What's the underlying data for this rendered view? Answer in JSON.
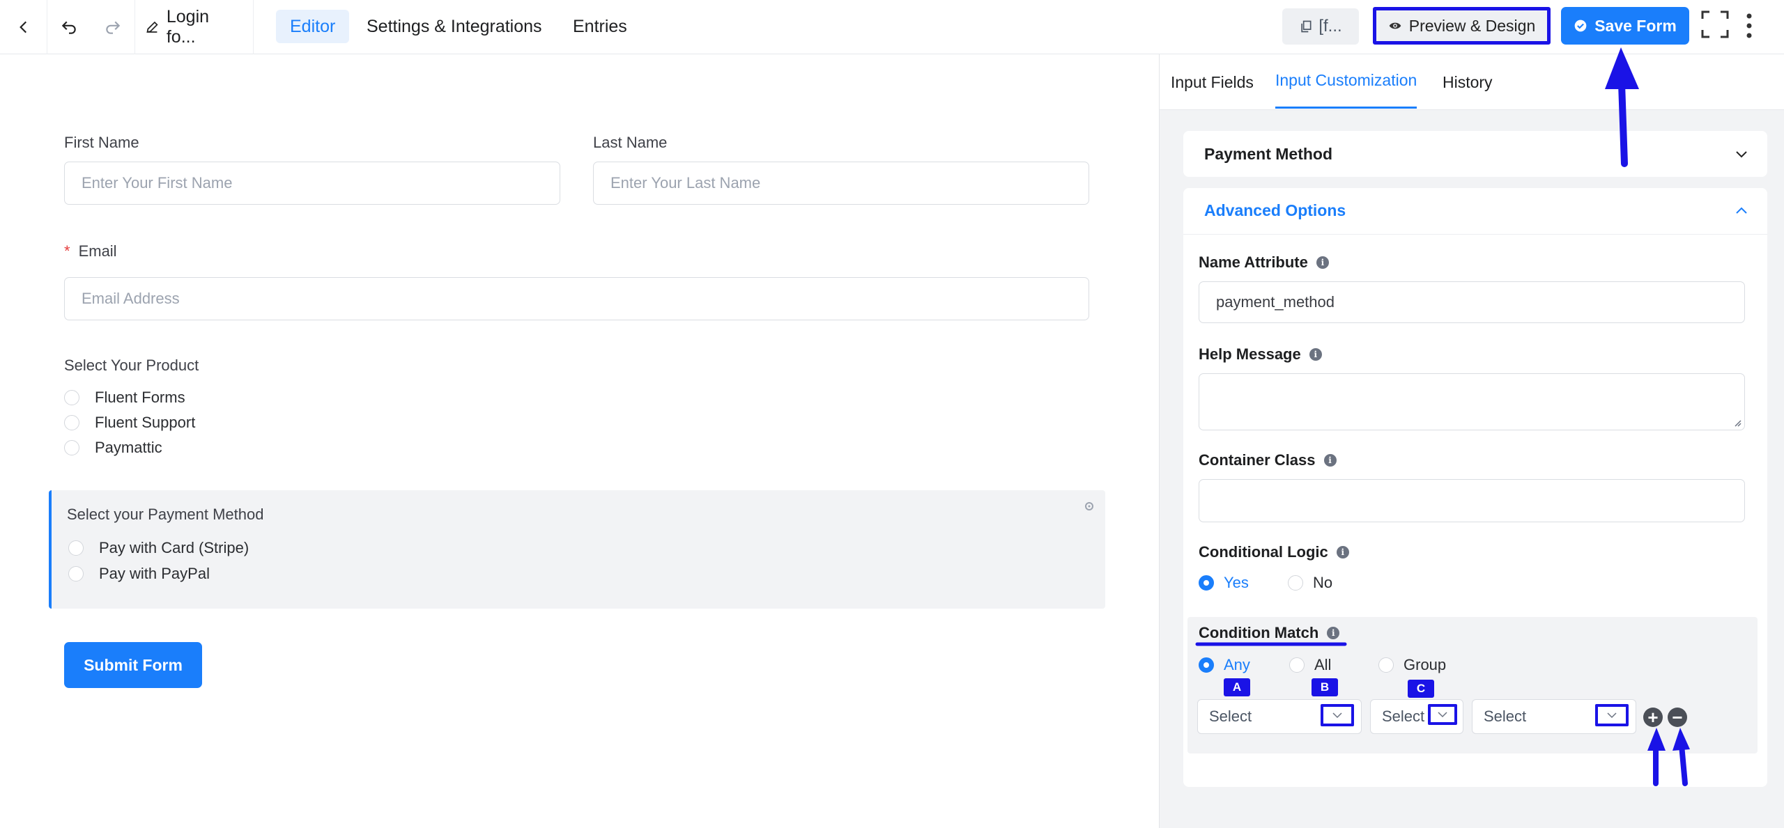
{
  "toolbar": {
    "form_title": "Login fo...",
    "tabs": [
      "Editor",
      "Settings & Integrations",
      "Entries"
    ],
    "shortcode": "[f...",
    "preview_label": "Preview & Design",
    "save_label": "Save Form"
  },
  "form": {
    "first_name_label": "First Name",
    "first_name_placeholder": "Enter Your First Name",
    "last_name_label": "Last Name",
    "last_name_placeholder": "Enter Your Last Name",
    "email_required_mark": "*",
    "email_label": "Email",
    "email_placeholder": "Email Address",
    "product_label": "Select Your Product",
    "products": [
      "Fluent Forms",
      "Fluent Support",
      "Paymattic"
    ],
    "payment_label": "Select your Payment Method",
    "payment_options": [
      "Pay with Card (Stripe)",
      "Pay with PayPal"
    ],
    "submit_label": "Submit Form"
  },
  "panel": {
    "tabs": [
      "Input Fields",
      "Input Customization",
      "History"
    ],
    "payment_method_header": "Payment Method",
    "advanced_header": "Advanced Options",
    "name_attribute_label": "Name Attribute",
    "name_attribute_value": "payment_method",
    "help_message_label": "Help Message",
    "help_message_value": "",
    "container_class_label": "Container Class",
    "container_class_value": "",
    "conditional_logic_label": "Conditional Logic",
    "conditional_logic_yes": "Yes",
    "conditional_logic_no": "No",
    "condition_match_label": "Condition Match",
    "match_options": [
      "Any",
      "All",
      "Group"
    ],
    "select_placeholder": "Select",
    "annotation_badges": [
      "A",
      "B",
      "C"
    ],
    "add_symbol": "+",
    "remove_symbol": "−",
    "info_symbol": "i"
  },
  "colors": {
    "accent": "#1a7efb",
    "annotation": "#1a13e6"
  }
}
